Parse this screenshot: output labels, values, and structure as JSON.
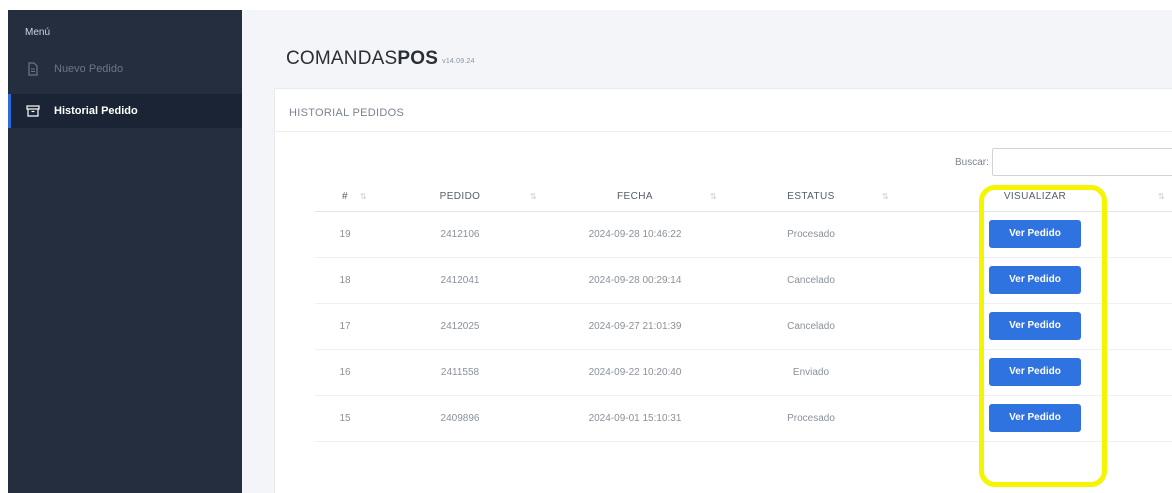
{
  "sidebar": {
    "menu_title": "Menú",
    "items": [
      {
        "label": "Nuevo Pedido",
        "icon": "document-icon",
        "active": false
      },
      {
        "label": "Historial Pedido",
        "icon": "archive-icon",
        "active": true
      }
    ]
  },
  "brand": {
    "prefix": "COMANDAS",
    "bold": "POS",
    "version": "v14.09.24"
  },
  "card": {
    "header": "HISTORIAL PEDIDOS"
  },
  "search": {
    "label": "Buscar:",
    "value": ""
  },
  "table": {
    "headers": [
      "#",
      "PEDIDO",
      "FECHA",
      "ESTATUS",
      "VISUALIZAR"
    ],
    "rows": [
      {
        "num": "19",
        "pedido": "2412106",
        "fecha": "2024-09-28 10:46:22",
        "estatus": "Procesado",
        "status_class": "st-procesado",
        "action": "Ver Pedido"
      },
      {
        "num": "18",
        "pedido": "2412041",
        "fecha": "2024-09-28 00:29:14",
        "estatus": "Cancelado",
        "status_class": "st-cancelado",
        "action": "Ver Pedido"
      },
      {
        "num": "17",
        "pedido": "2412025",
        "fecha": "2024-09-27 21:01:39",
        "estatus": "Cancelado",
        "status_class": "st-cancelado",
        "action": "Ver Pedido"
      },
      {
        "num": "16",
        "pedido": "2411558",
        "fecha": "2024-09-22 10:20:40",
        "estatus": "Enviado",
        "status_class": "st-enviado",
        "action": "Ver Pedido"
      },
      {
        "num": "15",
        "pedido": "2409896",
        "fecha": "2024-09-01 15:10:31",
        "estatus": "Procesado",
        "status_class": "st-procesado",
        "action": "Ver Pedido"
      }
    ]
  },
  "colors": {
    "sidebar_bg": "#242e3e",
    "primary_button": "#2f73e0",
    "link": "#5a8bd6",
    "status_procesado": "#3fb27f",
    "status_cancelado": "#e0566b",
    "status_enviado": "#f0b429",
    "highlight": "#f4f500"
  }
}
